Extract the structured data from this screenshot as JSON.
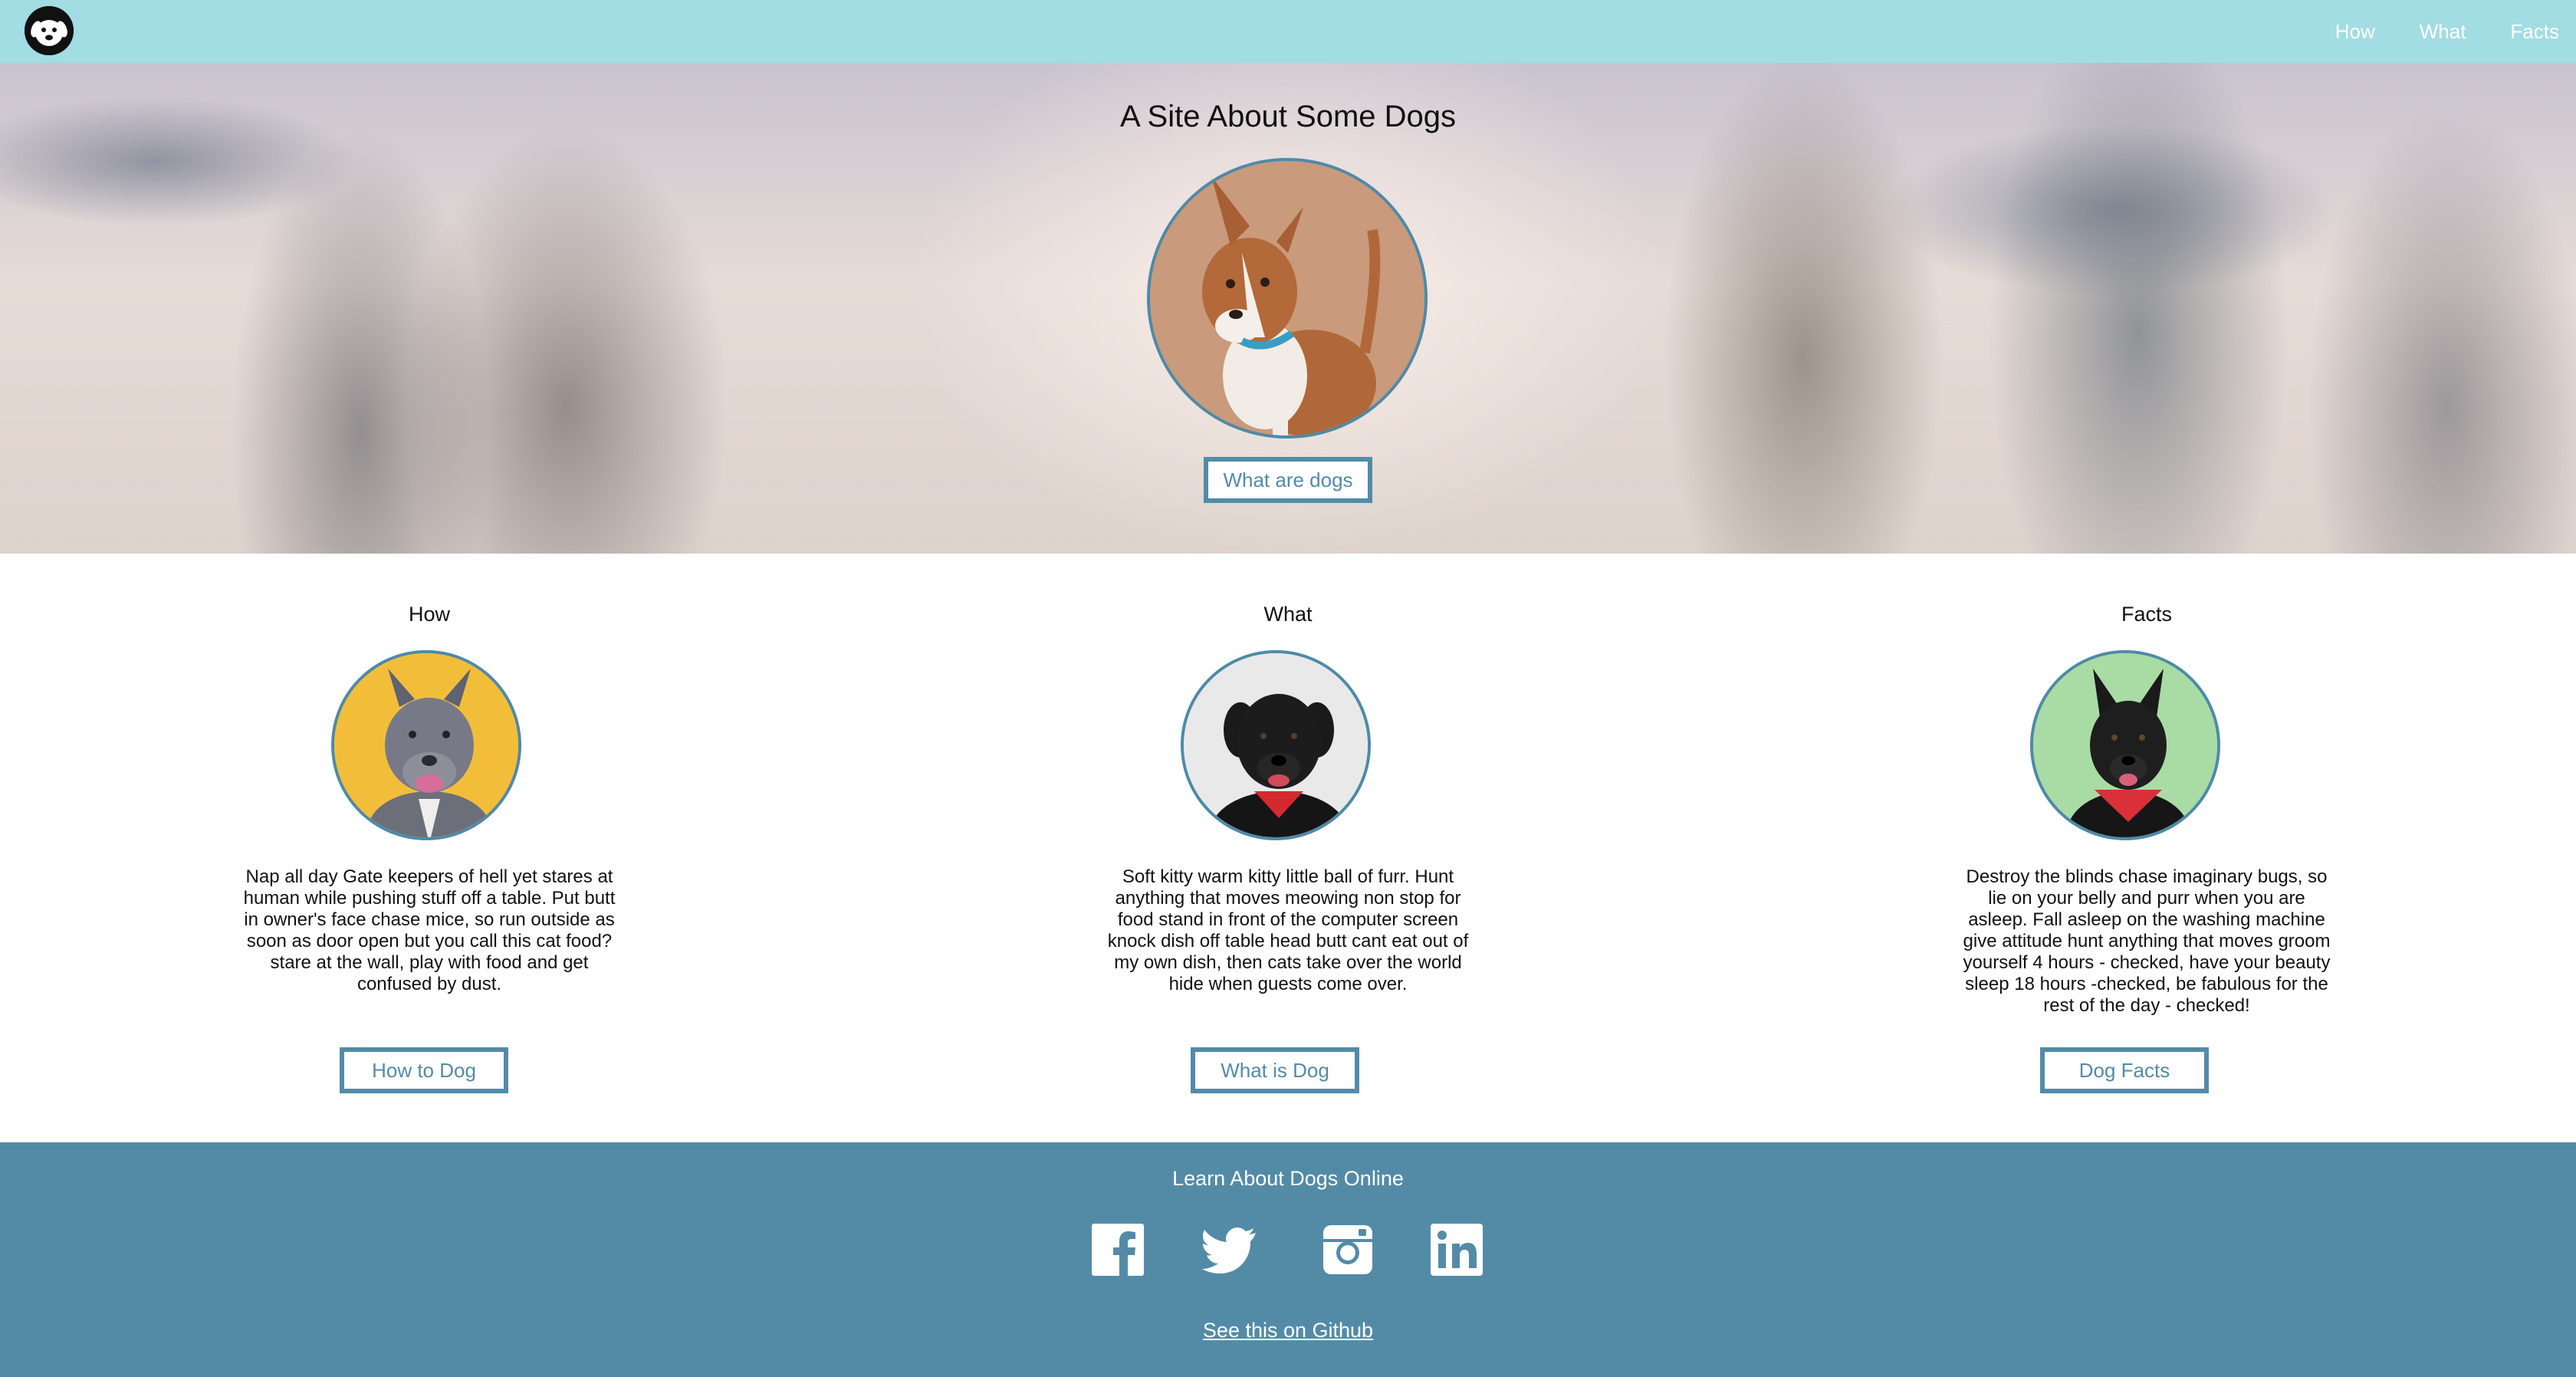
{
  "nav": {
    "logo_icon": "dog-face-logo-icon",
    "links": [
      "How",
      "What",
      "Facts"
    ]
  },
  "hero": {
    "title": "A Site About Some Dogs",
    "button_label": "What are dogs"
  },
  "features": [
    {
      "title": "How",
      "text": "Nap all day Gate keepers of hell yet stares at human while pushing stuff off a table. Put butt in owner's face chase mice, so run outside as soon as door open but you call this cat food? stare at the wall, play with food and get confused by dust.",
      "button_label": "How to Dog",
      "avatar_bg": "#f2be3a"
    },
    {
      "title": "What",
      "text": "Soft kitty warm kitty little ball of furr. Hunt anything that moves meowing non stop for food stand in front of the computer screen knock dish off table head butt cant eat out of my own dish, then cats take over the world hide when guests come over.",
      "button_label": "What is Dog",
      "avatar_bg": "#e9e9e9"
    },
    {
      "title": "Facts",
      "text": "Destroy the blinds chase imaginary bugs, so lie on your belly and purr when you are asleep. Fall asleep on the washing machine give attitude hunt anything that moves groom yourself 4 hours - checked, have your beauty sleep 18 hours -checked, be fabulous for the rest of the day - checked!",
      "button_label": "Dog Facts",
      "avatar_bg": "#a9dca4"
    }
  ],
  "footer": {
    "title": "Learn About Dogs Online",
    "social_icons": [
      "facebook-icon",
      "twitter-icon",
      "instagram-icon",
      "linkedin-icon"
    ],
    "github_link": "See this on Github"
  },
  "colors": {
    "nav_bg": "#a2dde3",
    "accent": "#528ba8",
    "footer_bg": "#538ba7"
  }
}
